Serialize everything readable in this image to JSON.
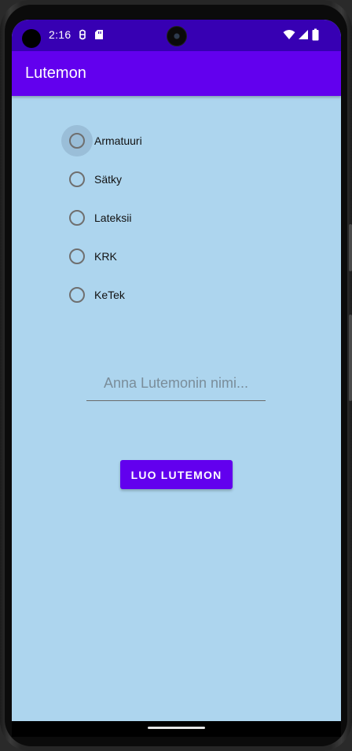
{
  "status_bar": {
    "time": "2:16",
    "icons": [
      "debug-icon",
      "sd-card-icon",
      "wifi-icon",
      "signal-icon",
      "battery-icon"
    ]
  },
  "app_bar": {
    "title": "Lutemon"
  },
  "radio_group": {
    "options": [
      {
        "label": "Armatuuri",
        "selected": false,
        "focused": true
      },
      {
        "label": "Sätky",
        "selected": false,
        "focused": false
      },
      {
        "label": "Lateksii",
        "selected": false,
        "focused": false
      },
      {
        "label": "KRK",
        "selected": false,
        "focused": false
      },
      {
        "label": "KeTek",
        "selected": false,
        "focused": false
      }
    ]
  },
  "name_field": {
    "value": "",
    "placeholder": "Anna Lutemonin nimi..."
  },
  "create_button": {
    "label": "LUO LUTEMON"
  },
  "colors": {
    "status_bar": "#3700b3",
    "primary": "#6200ee",
    "background": "#add5ee"
  }
}
